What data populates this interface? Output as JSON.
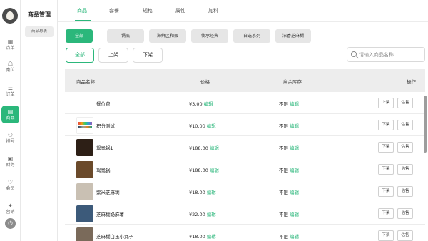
{
  "rail": {
    "items": [
      {
        "label": "点单",
        "icon": "▦"
      },
      {
        "label": "桌位",
        "icon": "☖"
      },
      {
        "label": "订单",
        "icon": "☰"
      },
      {
        "label": "商品",
        "icon": "▤"
      },
      {
        "label": "排号",
        "icon": "⚇"
      },
      {
        "label": "财务",
        "icon": "▣"
      },
      {
        "label": "会员",
        "icon": "♡"
      },
      {
        "label": "营销",
        "icon": "✦"
      }
    ],
    "active_index": 3,
    "power_icon": "⏻"
  },
  "sub": {
    "title": "商品管理",
    "item": "商品总表"
  },
  "tabs": [
    "商品",
    "套餐",
    "规格",
    "属性",
    "加料"
  ],
  "categories": [
    "全部",
    "锅底",
    "海鲜区和蛋",
    "传承经典",
    "自选系列",
    "浓香芝麻糊"
  ],
  "status_filters": [
    "全部",
    "上架",
    "下架"
  ],
  "search": {
    "placeholder": "请输入商品名称",
    "value": ""
  },
  "table": {
    "headers": [
      "商品名称",
      "价格",
      "剩余库存",
      "操作"
    ],
    "edit_label": "编辑",
    "rows": [
      {
        "name": "餐位费",
        "price": "¥3.00",
        "stock": "不限",
        "action": "上架",
        "sell": "估售"
      },
      {
        "name": "积分测试",
        "price": "¥10.00",
        "stock": "不限",
        "action": "下架",
        "sell": "估售"
      },
      {
        "name": "鸳鸯锅1",
        "price": "¥188.00",
        "stock": "不限",
        "action": "下架",
        "sell": "估售"
      },
      {
        "name": "鸳鸯锅",
        "price": "¥188.00",
        "stock": "不限",
        "action": "下架",
        "sell": "估售"
      },
      {
        "name": "紫米芝麻糊",
        "price": "¥18.00",
        "stock": "不限",
        "action": "下架",
        "sell": "估售"
      },
      {
        "name": "芝麻糊奶麻薯",
        "price": "¥22.00",
        "stock": "不限",
        "action": "下架",
        "sell": "估售"
      },
      {
        "name": "芝麻糊白玉小丸子",
        "price": "¥18.00",
        "stock": "不限",
        "action": "下架",
        "sell": "估售"
      }
    ]
  },
  "colors": {
    "accent": "#2bb77b",
    "header_bg": "#ededed"
  }
}
